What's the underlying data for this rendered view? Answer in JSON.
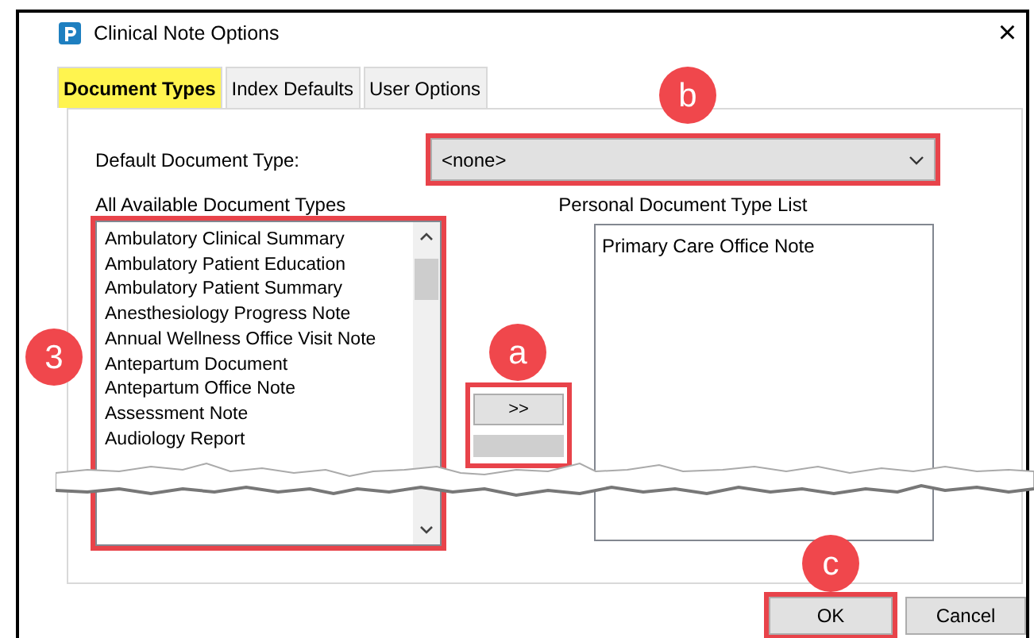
{
  "window": {
    "title": "Clinical Note Options",
    "close": "×"
  },
  "tabs": [
    {
      "label": "Document Types",
      "selected": true,
      "highlighted": true
    },
    {
      "label": "Index Defaults",
      "selected": false,
      "highlighted": false
    },
    {
      "label": "User Options",
      "selected": false,
      "highlighted": false
    }
  ],
  "default_document_type": {
    "label": "Default Document Type:",
    "value": "<none>",
    "callout": "b"
  },
  "available_list": {
    "heading": "All Available Document Types",
    "callout": "3",
    "items": [
      "Ambulatory Clinical Summary",
      "Ambulatory Patient Education",
      "Ambulatory Patient Summary",
      "Anesthesiology Progress Note",
      "Annual Wellness Office Visit Note",
      "Antepartum Document",
      "Antepartum Office Note",
      "Assessment Note",
      "Audiology Report"
    ]
  },
  "transfer": {
    "label": ">>",
    "callout": "a"
  },
  "personal_list": {
    "heading": "Personal Document Type List",
    "items": [
      "Primary Care Office Note"
    ]
  },
  "buttons": [
    {
      "label": "OK",
      "callout": "c"
    },
    {
      "label": "Cancel"
    }
  ]
}
